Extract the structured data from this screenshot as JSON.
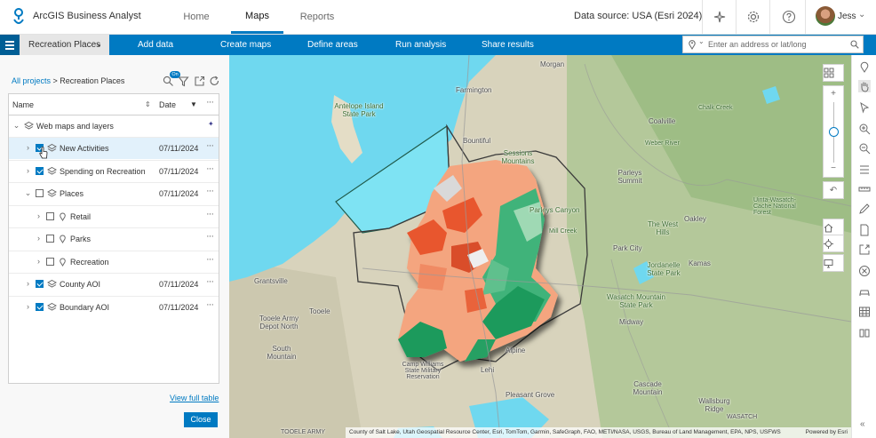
{
  "app": {
    "title": "ArcGIS Business Analyst"
  },
  "topnav": [
    {
      "label": "Home",
      "active": false
    },
    {
      "label": "Maps",
      "active": true
    },
    {
      "label": "Reports",
      "active": false
    }
  ],
  "header": {
    "datasource": "Data source: USA (Esri 2024)",
    "user_name": "Jess",
    "icons": [
      "insights-icon",
      "gear-icon",
      "help-icon",
      "chevron-down-icon"
    ]
  },
  "actionbar": {
    "project": "Recreation Places",
    "actions": [
      "Add data",
      "Create maps",
      "Define areas",
      "Run analysis",
      "Share results"
    ],
    "search_placeholder": "Enter an address or lat/long"
  },
  "panel": {
    "breadcrumb_root": "All projects",
    "breadcrumb_current": "Recreation Places",
    "filter_badge": "On",
    "columns": {
      "name": "Name",
      "date": "Date"
    },
    "group_label": "Web maps and layers",
    "rows": [
      {
        "label": "New Activities",
        "date": "07/11/2024",
        "checked": true,
        "selected": true,
        "icon": "layers-icon",
        "indent": 1,
        "expander": ">"
      },
      {
        "label": "Spending on Recreation",
        "date": "07/11/2024",
        "checked": true,
        "selected": false,
        "icon": "layers-icon",
        "indent": 1,
        "expander": ">"
      },
      {
        "label": "Places",
        "date": "07/11/2024",
        "checked": false,
        "selected": false,
        "icon": "layers-icon",
        "indent": 1,
        "expander": "v"
      },
      {
        "label": "Retail",
        "date": "",
        "checked": false,
        "selected": false,
        "icon": "pin-icon",
        "indent": 2,
        "expander": ">"
      },
      {
        "label": "Parks",
        "date": "",
        "checked": false,
        "selected": false,
        "icon": "pin-icon",
        "indent": 2,
        "expander": ">"
      },
      {
        "label": "Recreation",
        "date": "",
        "checked": false,
        "selected": false,
        "icon": "pin-icon",
        "indent": 2,
        "expander": ">"
      },
      {
        "label": "County AOI",
        "date": "07/11/2024",
        "checked": true,
        "selected": false,
        "icon": "layers-icon",
        "indent": 1,
        "expander": ">"
      },
      {
        "label": "Boundary AOI",
        "date": "07/11/2024",
        "checked": true,
        "selected": false,
        "icon": "layers-icon",
        "indent": 1,
        "expander": ">"
      }
    ],
    "view_full_table": "View full table",
    "close_label": "Close"
  },
  "map": {
    "labels": [
      "Morgan",
      "Farmington",
      "Antelope Island State Park",
      "Bountiful",
      "Sessions Mountains",
      "Coalville",
      "Parleys Canyon",
      "Parleys Summit",
      "The West Hills",
      "Oakley",
      "Grantsville",
      "Park City",
      "Kamas",
      "Jordanelle State Park",
      "Tooele",
      "Tooele Army Depot North",
      "Wasatch Mountain State Park",
      "Midway",
      "South Mountain",
      "Camp Williams State Military Reservation",
      "Alpine",
      "Lehi",
      "Pleasant Grove",
      "Cascade Mountain",
      "Wallsburg Ridge",
      "Chalk Creek",
      "Weber River",
      "Uinta-Wasatch-Cache National Forest",
      "TOOELE ARMY",
      "WASATCH",
      "Mill Creek"
    ],
    "attribution": "County of Salt Lake, Utah Geospatial Resource Center, Esri, TomTom, Garmin, SafeGraph, FAO, METI/NASA, USGS, Bureau of Land Management, EPA, NPS, USFWS",
    "powered_by": "Powered by Esri",
    "zoom_in": "+",
    "zoom_out": "−",
    "zoom_level_fraction": 0.55
  },
  "colors": {
    "accent": "#007ac2",
    "water": "#6fd8ef",
    "choropleth_low": "#f4a57f",
    "choropleth_high": "#1f9a5c",
    "choropleth_mid": "#e8562f"
  }
}
